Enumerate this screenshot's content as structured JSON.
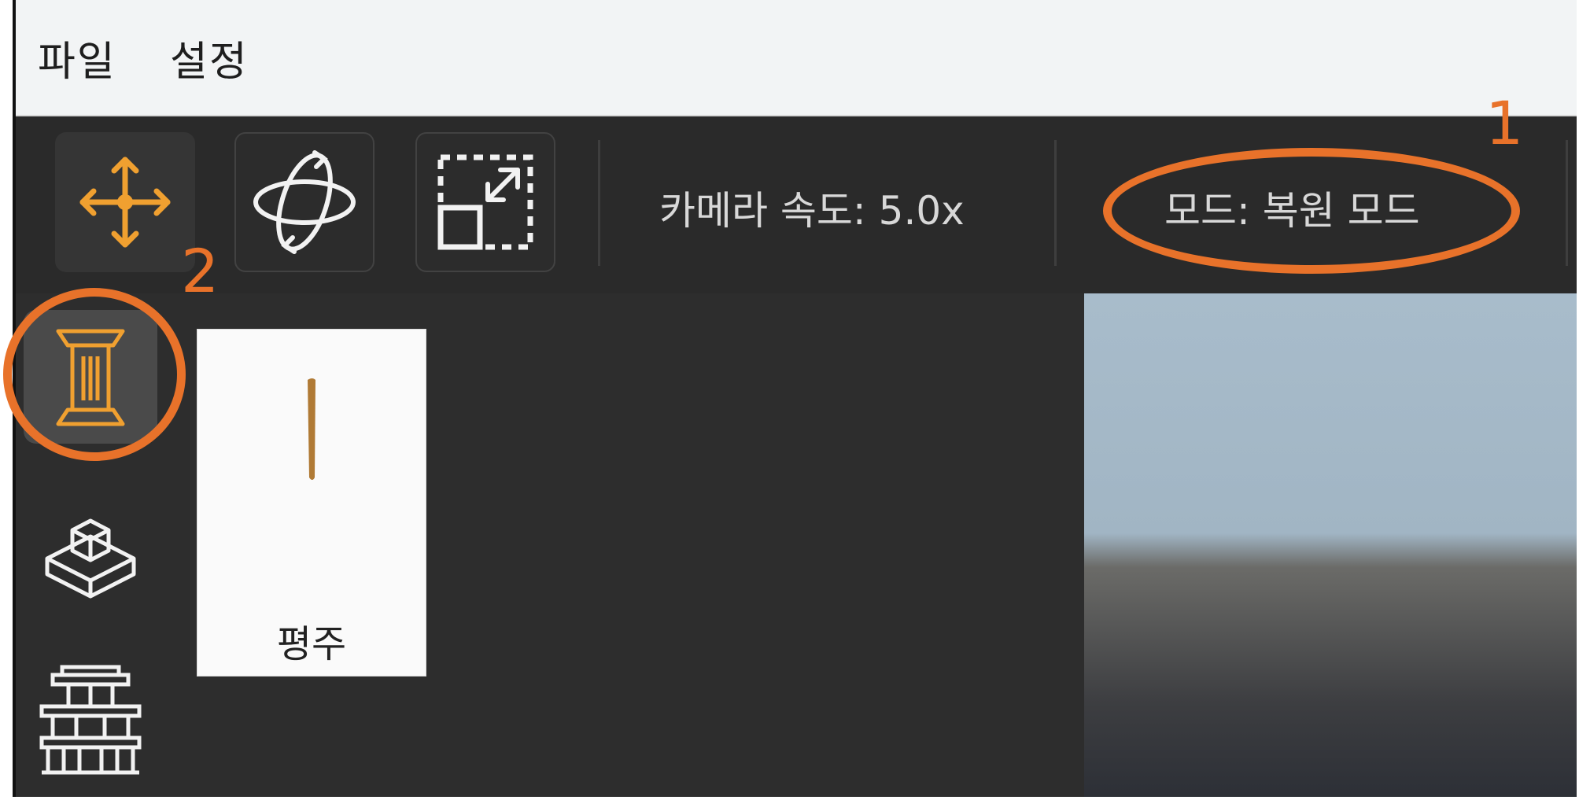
{
  "menu": {
    "file": "파일",
    "settings": "설정"
  },
  "toolbar": {
    "tools": [
      {
        "name": "move-tool",
        "icon": "move-arrows-icon",
        "active": true
      },
      {
        "name": "rotate-tool",
        "icon": "orbit-rotate-icon",
        "active": false
      },
      {
        "name": "scale-tool",
        "icon": "scale-box-icon",
        "active": false
      }
    ],
    "camera_speed_text": "카메라 속도: 5.0x",
    "mode_text": "모드: 복원 모드"
  },
  "side_tools": [
    {
      "icon": "pillar-icon",
      "active": true
    },
    {
      "icon": "block-base-icon",
      "active": false
    },
    {
      "icon": "structure-frame-icon",
      "active": false
    }
  ],
  "asset_panel": {
    "items": [
      {
        "label": "평주",
        "icon": "pillar-thumbnail-icon"
      }
    ]
  },
  "annotations": {
    "marker_1": "1",
    "marker_2": "2"
  },
  "colors": {
    "accent": "#f0a030",
    "annotation": "#e8722a",
    "toolbar_bg": "#2a2a2a",
    "panel_bg": "#2d2d2d",
    "menubar_bg": "#f2f4f5"
  }
}
